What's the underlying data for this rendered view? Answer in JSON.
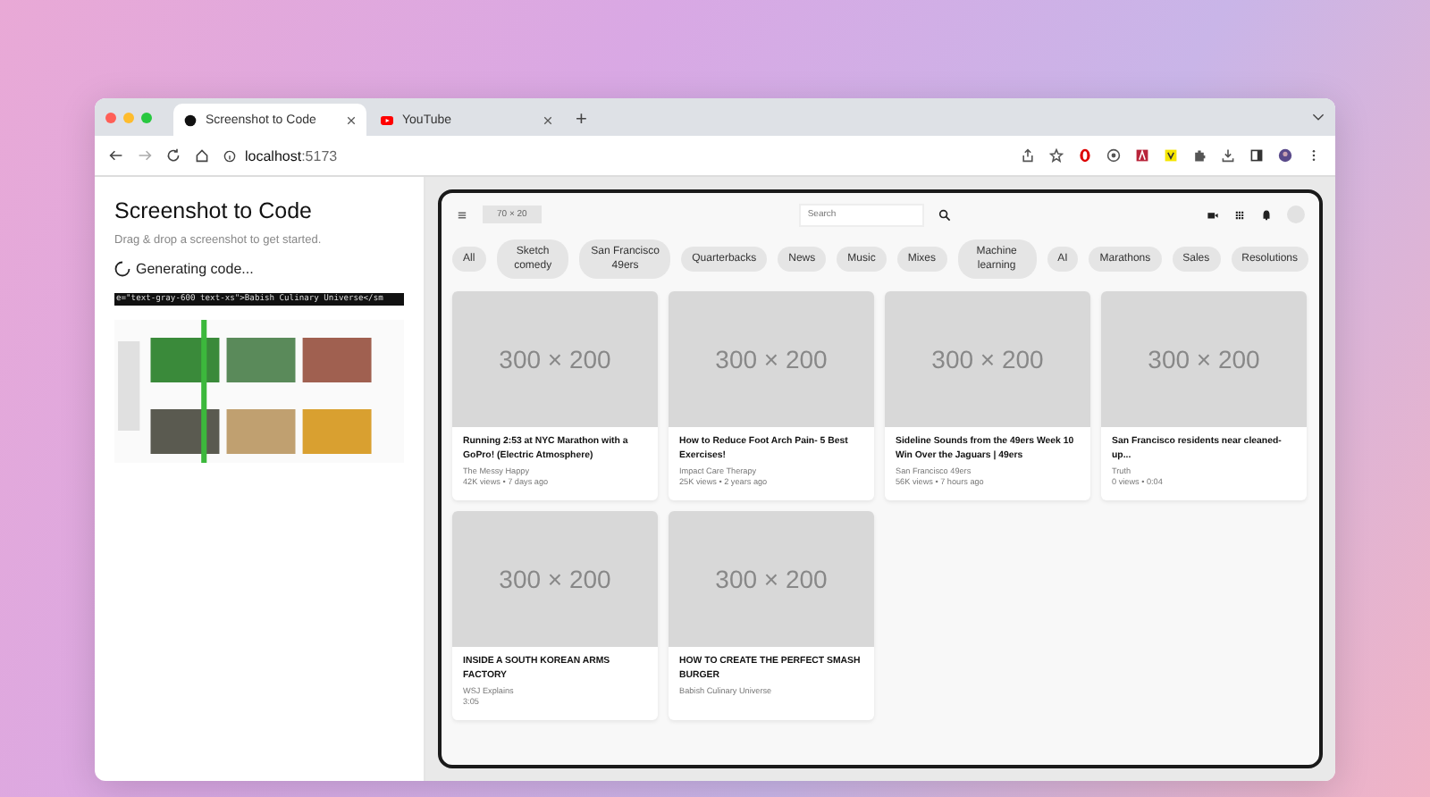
{
  "browser": {
    "tabs": [
      {
        "title": "Screenshot to Code",
        "kind": "app",
        "selected": true
      },
      {
        "title": "YouTube",
        "kind": "youtube",
        "selected": false
      }
    ],
    "new_tab": "+",
    "url_host": "localhost",
    "url_port": ":5173"
  },
  "app": {
    "title": "Screenshot to Code",
    "subtitle": "Drag & drop a screenshot to get started.",
    "status": "Generating code...",
    "code_line": "e=\"text-gray-600 text-xs\">Babish Culinary Universe</sm"
  },
  "preview": {
    "logo": "70 × 20",
    "search": {
      "placeholder": "Search"
    },
    "chips": [
      {
        "label": "All"
      },
      {
        "label": "Sketch comedy"
      },
      {
        "label": "San Francisco 49ers"
      },
      {
        "label": "Quarterbacks"
      },
      {
        "label": "News"
      },
      {
        "label": "Music"
      },
      {
        "label": "Mixes"
      },
      {
        "label": "Machine learning"
      },
      {
        "label": "AI"
      },
      {
        "label": "Marathons"
      },
      {
        "label": "Sales"
      },
      {
        "label": "Resolutions"
      }
    ],
    "videos": [
      {
        "thumb": "300 × 200",
        "title": "Running 2:53 at NYC Marathon with a GoPro! (Electric Atmosphere)",
        "channel": "The Messy Happy",
        "meta": "42K views • 7 days ago"
      },
      {
        "thumb": "300 × 200",
        "title": "How to Reduce Foot Arch Pain- 5 Best Exercises!",
        "channel": "Impact Care Therapy",
        "meta": "25K views • 2 years ago"
      },
      {
        "thumb": "300 × 200",
        "title": "Sideline Sounds from the 49ers Week 10 Win Over the Jaguars | 49ers",
        "channel": "San Francisco 49ers",
        "meta": "56K views • 7 hours ago"
      },
      {
        "thumb": "300 × 200",
        "title": "San Francisco residents near cleaned-up...",
        "channel": "Truth",
        "meta": "0 views • 0:04"
      },
      {
        "thumb": "300 × 200",
        "title": "INSIDE A SOUTH KOREAN ARMS FACTORY",
        "channel": "WSJ Explains",
        "meta": "3:05"
      },
      {
        "thumb": "300 × 200",
        "title": "HOW TO CREATE THE PERFECT SMASH BURGER",
        "channel": "Babish Culinary Universe"
      }
    ]
  }
}
